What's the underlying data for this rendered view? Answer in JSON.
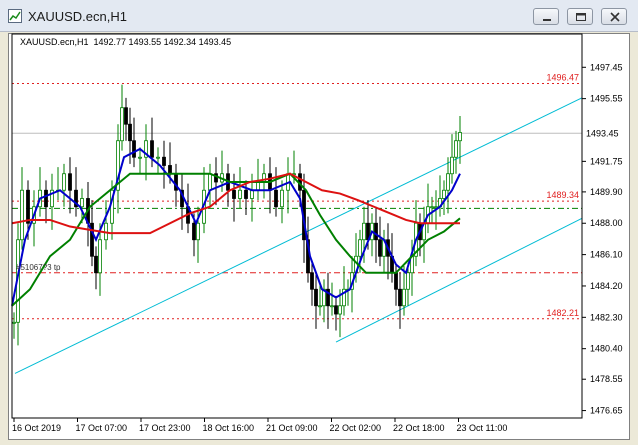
{
  "window": {
    "title": "XAUUSD.ecn,H1",
    "app_icon": "chart-window-icon",
    "buttons": [
      {
        "name": "minimize-button",
        "icon": "minimize-icon"
      },
      {
        "name": "restore-button",
        "icon": "restore-icon"
      },
      {
        "name": "close-button",
        "icon": "close-icon"
      }
    ]
  },
  "chart": {
    "symbol_info": "XAUUSD.ecn,H1  1492.77 1493.55 1492.34 1493.45",
    "current_price_label": "1493.45",
    "price_levels": [
      {
        "label": "1496.47",
        "value": 1496.47,
        "color": "#e02020",
        "style": "dotted"
      },
      {
        "label": "1489.34",
        "value": 1489.34,
        "color": "#e02020",
        "style": "dotted"
      },
      {
        "label": "1482.21",
        "value": 1482.21,
        "color": "#e02020",
        "style": "dotted"
      }
    ],
    "order_lines": [
      {
        "label": "#51067?3 tp",
        "value": 1485.0,
        "color": "#e02020",
        "style": "dashdot"
      },
      {
        "label": "",
        "value": 1488.9,
        "color": "#008000",
        "style": "dashdot"
      }
    ],
    "colors": {
      "bull": "#008000",
      "bear": "#000000",
      "ma_fast": "#0000cc",
      "ma_mid": "#008000",
      "ma_slow": "#dd1111",
      "channel": "#00bcd4",
      "level": "#e02020",
      "current": "#bdbdbd"
    }
  },
  "chart_data": {
    "type": "candlestick",
    "y_ticks": [
      "1497.45",
      "1495.55",
      "1493.45",
      "1491.75",
      "1489.90",
      "1488.00",
      "1486.10",
      "1484.20",
      "1482.30",
      "1480.40",
      "1478.55",
      "1476.65"
    ],
    "y_tick_values": [
      1497.45,
      1495.55,
      1493.45,
      1491.75,
      1489.9,
      1488.0,
      1486.1,
      1484.2,
      1482.3,
      1480.4,
      1478.55,
      1476.65
    ],
    "x_ticks": [
      "16 Oct 2019",
      "17 Oct 07:00",
      "17 Oct 23:00",
      "18 Oct 16:00",
      "21 Oct 09:00",
      "22 Oct 02:00",
      "22 Oct 18:00",
      "23 Oct 11:00"
    ],
    "ylim": [
      1476.2,
      1498.8
    ]
  }
}
